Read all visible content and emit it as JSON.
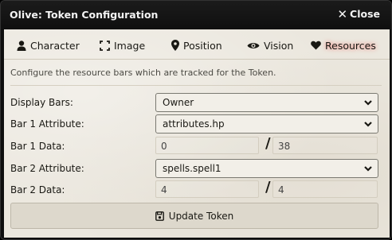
{
  "window": {
    "title": "Olive: Token Configuration",
    "close_label": "Close"
  },
  "tabs": [
    {
      "label": "Character",
      "icon": "user-icon"
    },
    {
      "label": "Image",
      "icon": "expand-icon"
    },
    {
      "label": "Position",
      "icon": "map-marker-icon"
    },
    {
      "label": "Vision",
      "icon": "eye-icon"
    },
    {
      "label": "Resources",
      "icon": "heart-icon",
      "active": true
    }
  ],
  "hint": "Configure the resource bars which are tracked for the Token.",
  "fields": {
    "display_bars": {
      "label": "Display Bars:",
      "value": "Owner"
    },
    "bar1_attribute": {
      "label": "Bar 1 Attribute:",
      "value": "attributes.hp"
    },
    "bar1_data": {
      "label": "Bar 1 Data:",
      "value": "0",
      "max": "38"
    },
    "bar2_attribute": {
      "label": "Bar 2 Attribute:",
      "value": "spells.spell1"
    },
    "bar2_data": {
      "label": "Bar 2 Data:",
      "value": "4",
      "max": "4"
    }
  },
  "slash": "/",
  "update_button": {
    "label": "Update Token",
    "icon": "save-icon"
  },
  "colors": {
    "active_glow": "#ff0000",
    "panel_bg": "#ebe7de"
  }
}
